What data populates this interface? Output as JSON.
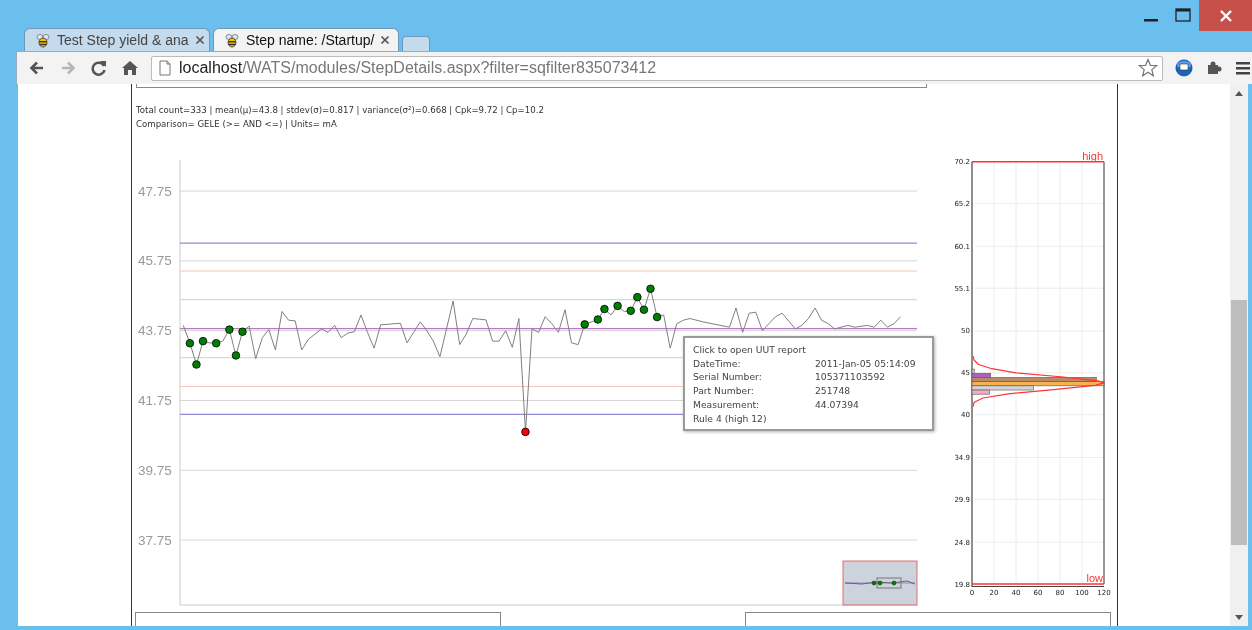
{
  "tabs": [
    {
      "label": "Test Step yield & ana",
      "selected": false
    },
    {
      "label": "Step name: /Startup/",
      "selected": true
    }
  ],
  "toolbar": {
    "nav_buttons": [
      {
        "kind": "back",
        "disabled": false
      },
      {
        "kind": "forward",
        "disabled": true
      },
      {
        "kind": "reload",
        "disabled": false
      },
      {
        "kind": "home",
        "disabled": false
      }
    ],
    "address": {
      "host": "localhost",
      "path": "/WATS/modules/StepDetails.aspx?filter=sqfilter835073412"
    }
  },
  "summary_lines": [
    "Total count=333 | mean(μ)=43.8 | stdev(σ)=0.817 | variance(σ²)=0.668 | Cpk=9.72 | Cp=10.2",
    "Comparison= GELE (>= AND <=) | Units= mA"
  ],
  "run_chart": {
    "chart_data": {
      "type": "line",
      "grid": true,
      "categories": [
        null,
        null,
        null,
        null,
        null,
        null,
        null,
        null,
        null,
        null,
        null,
        null,
        null,
        null,
        null,
        null,
        null,
        null,
        null,
        null,
        null,
        null,
        null,
        null,
        null,
        null,
        null,
        null,
        null,
        null,
        null,
        null,
        null,
        null,
        null,
        null,
        null,
        null,
        null,
        null,
        null,
        null,
        null,
        null,
        null,
        null,
        null,
        null,
        null,
        null,
        null,
        null,
        null,
        null,
        null,
        null,
        null,
        null,
        null,
        null,
        null,
        null,
        null,
        null,
        null,
        null,
        null,
        null,
        null,
        null,
        null,
        null,
        null,
        null,
        null,
        null,
        null,
        null,
        null,
        null,
        null,
        null,
        null,
        null,
        null,
        null,
        null,
        null,
        null,
        null,
        null,
        null,
        null,
        null,
        null,
        null,
        null,
        null,
        null,
        null,
        null,
        null,
        null,
        null,
        null,
        null,
        null,
        null,
        null,
        null,
        null,
        null
      ],
      "ylim": [
        35.89,
        48.64
      ],
      "yticks": [
        37.75,
        39.75,
        41.75,
        43.75,
        45.75,
        47.75
      ],
      "series": [
        {
          "color": "#808080",
          "values": [
            43.9,
            43.39,
            42.78,
            43.45,
            43.4,
            43.39,
            43.45,
            43.78,
            43.04,
            43.72,
            43.88,
            42.95,
            43.55,
            43.78,
            43.2,
            44.3,
            44.05,
            44.03,
            43.2,
            43.5,
            43.65,
            43.8,
            43.7,
            43.9,
            43.55,
            43.68,
            43.72,
            44.2,
            43.7,
            43.25,
            43.92,
            43.93,
            43.95,
            43.96,
            43.4,
            43.7,
            44.0,
            43.75,
            43.45,
            43.0,
            43.8,
            44.6,
            43.35,
            43.65,
            44.1,
            44.08,
            44.06,
            43.45,
            43.45,
            43.75,
            43.27,
            44.1,
            40.85,
            43.8,
            43.7,
            44.15,
            43.95,
            43.7,
            44.35,
            43.4,
            43.35,
            43.93,
            44.0,
            44.07,
            44.37,
            44.2,
            44.46,
            44.3,
            44.32,
            44.71,
            44.35,
            44.95,
            44.14,
            44.2,
            43.25,
            43.95,
            44.05,
            44.1,
            null,
            44.0,
            null,
            null,
            null,
            43.85,
            44.4,
            43.7,
            44.25,
            44.28,
            43.75,
            43.95,
            44.15,
            44.25,
            null,
            43.8,
            43.9,
            44.1,
            44.4,
            44.05,
            43.95,
            43.8,
            null,
            43.9,
            43.85,
            null,
            43.9,
            43.85,
            44.05,
            43.85,
            43.95,
            44.15,
            null,
            null
          ]
        },
        {
          "type": "scatter",
          "color": "#008000",
          "values": [
            null,
            43.39,
            42.78,
            43.45,
            null,
            43.39,
            null,
            43.78,
            43.04,
            43.72,
            null,
            null,
            null,
            null,
            null,
            null,
            null,
            null,
            null,
            null,
            null,
            null,
            null,
            null,
            null,
            null,
            null,
            null,
            null,
            null,
            null,
            null,
            null,
            null,
            null,
            null,
            null,
            null,
            null,
            null,
            null,
            null,
            null,
            null,
            null,
            null,
            null,
            null,
            null,
            null,
            null,
            null,
            null,
            null,
            null,
            null,
            null,
            null,
            null,
            null,
            null,
            43.93,
            null,
            44.07,
            44.37,
            null,
            44.46,
            null,
            44.32,
            44.71,
            44.35,
            44.95,
            44.14,
            null,
            null,
            null,
            null,
            null,
            null,
            null,
            null,
            null,
            null,
            null,
            null,
            null,
            null,
            null,
            null,
            null,
            null,
            null,
            null,
            null,
            null,
            null,
            null,
            null,
            null,
            null,
            null,
            null,
            null,
            null,
            null,
            null,
            null,
            null,
            null,
            null,
            null,
            null
          ]
        },
        {
          "type": "scatter",
          "color": "#ff0000",
          "values": [
            null,
            null,
            null,
            null,
            null,
            null,
            null,
            null,
            null,
            null,
            null,
            null,
            null,
            null,
            null,
            null,
            null,
            null,
            null,
            null,
            null,
            null,
            null,
            null,
            null,
            null,
            null,
            null,
            null,
            null,
            null,
            null,
            null,
            null,
            null,
            null,
            null,
            null,
            null,
            null,
            null,
            null,
            null,
            null,
            null,
            null,
            null,
            null,
            null,
            null,
            null,
            null,
            40.85,
            null,
            null,
            null,
            null,
            null,
            null,
            null,
            null,
            null,
            null,
            null,
            null,
            null,
            null,
            null,
            null,
            null,
            null,
            null,
            null,
            null,
            null,
            null,
            null,
            null,
            null,
            null,
            null,
            null,
            null,
            null,
            null,
            null,
            null,
            null,
            null,
            null,
            null,
            null,
            null,
            null,
            null,
            null,
            null,
            null,
            null,
            null,
            null,
            null,
            null,
            null,
            null,
            null,
            null,
            null,
            null,
            null,
            null,
            null
          ]
        }
      ],
      "ref_lines": [
        {
          "axis": "y",
          "value": 46.26,
          "color": "#8c8cd2"
        },
        {
          "axis": "y",
          "value": 45.46,
          "color": "#f7c4b8"
        },
        {
          "axis": "y",
          "value": 44.64,
          "color": "#c4e8c4"
        },
        {
          "axis": "y",
          "value": 43.81,
          "color": "#b77bc4"
        },
        {
          "axis": "y",
          "value": 42.98,
          "color": "#c4e8c4"
        },
        {
          "axis": "y",
          "value": 42.15,
          "color": "#f7c4b8"
        },
        {
          "axis": "y",
          "value": 41.35,
          "color": "#8c8cd2"
        }
      ]
    },
    "tooltip": {
      "title": "Click to open UUT report",
      "rows": [
        {
          "label": "DateTime:",
          "value": "2011-Jan-05 05:14:09"
        },
        {
          "label": "Serial Number:",
          "value": "105371103592"
        },
        {
          "label": "Part Number:",
          "value": "251748"
        },
        {
          "label": "Measurement:",
          "value": "44.07394"
        }
      ],
      "footer": "Rule 4 (high 12)"
    }
  },
  "histogram": {
    "chart_data": {
      "type": "bar",
      "orientation": "horizontal",
      "grid": true,
      "x": [
        45.2,
        44.7,
        44.2,
        43.7,
        43.2,
        42.7
      ],
      "xlim": [
        0,
        120
      ],
      "xticks": [
        0,
        20,
        40,
        60,
        80,
        100,
        120
      ],
      "ylim": [
        19.8,
        70.2
      ],
      "yticks": [
        70.2,
        65.2,
        60.1,
        55.1,
        50,
        45,
        40,
        34.9,
        29.9,
        24.8,
        19.8
      ],
      "series": [
        {
          "color": "#d0d0d0",
          "values": [
            2,
            null,
            null,
            null,
            null,
            null
          ]
        },
        {
          "color": "#b060c0",
          "values": [
            null,
            17,
            null,
            null,
            null,
            null
          ]
        },
        {
          "color": "#b98a6a",
          "values": [
            null,
            null,
            113,
            null,
            null,
            null
          ]
        },
        {
          "color": "#f6b24e",
          "values": [
            null,
            null,
            null,
            120,
            null,
            null
          ]
        },
        {
          "color": "#d4d4d4",
          "values": [
            null,
            null,
            null,
            null,
            56,
            null
          ]
        },
        {
          "color": "#f4a8c8",
          "values": [
            null,
            null,
            null,
            null,
            null,
            16
          ]
        },
        {
          "type": "line",
          "color": "#ff3333",
          "x": [
            47,
            46.5,
            46,
            45.5,
            45,
            44.5,
            44,
            43.8,
            43.5,
            43,
            42.5,
            42,
            41.5,
            41
          ],
          "values": [
            1,
            2,
            6,
            18,
            40,
            83,
            116,
            120,
            112,
            74,
            33,
            10,
            2,
            1
          ]
        }
      ],
      "ref_lines": [
        {
          "axis": "y",
          "value": 70.2,
          "label": "high",
          "color": "#ff3333"
        },
        {
          "axis": "y",
          "value": 19.8,
          "label": "low",
          "color": "#ff3333"
        }
      ]
    }
  }
}
